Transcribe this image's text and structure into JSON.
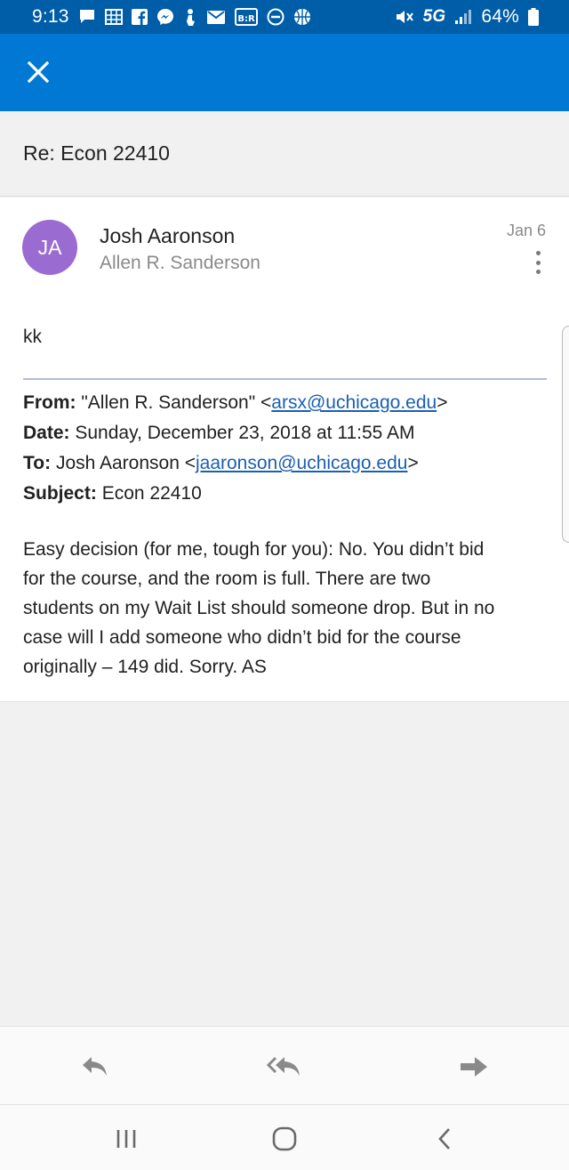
{
  "status_bar": {
    "time": "9:13",
    "network": "5G",
    "battery": "64%",
    "left_icons": [
      "chat-icon",
      "calendar-grid-icon",
      "facebook-icon",
      "messenger-icon",
      "touch-icon",
      "mail-icon",
      "br-app-icon",
      "minus-circle-icon",
      "basketball-icon"
    ],
    "br_label": "B:R",
    "right_icons": [
      "mute-icon",
      "signal-icon",
      "battery-icon"
    ]
  },
  "app_bar": {
    "close_icon": "close-icon",
    "color": "#0078d4"
  },
  "thread": {
    "subject": "Re: Econ 22410"
  },
  "message": {
    "avatar_initials": "JA",
    "avatar_color": "#9a6bd1",
    "sender": "Josh Aaronson",
    "recipient": "Allen R. Sanderson",
    "date": "Jan 6",
    "reply_text": "kk",
    "quoted_header": {
      "from_label": "From:",
      "from_name": "\"Allen R. Sanderson\" <",
      "from_email": "arsx@uchicago.edu",
      "from_suffix": ">",
      "date_label": "Date:",
      "date_value": "Sunday, December 23, 2018 at 11:55 AM",
      "to_label": "To:",
      "to_name": "Josh Aaronson <",
      "to_email": "jaaronson@uchicago.edu",
      "to_suffix": ">",
      "subject_label": "Subject:",
      "subject_value": "Econ 22410"
    },
    "body_lines": [
      "Easy decision (for me, tough for you): No. You didn’t bid",
      "for the course, and the room is full. There are two",
      "students on my Wait List should someone drop. But in no",
      "case will I add someone who didn’t bid for the course",
      "originally – 149 did. Sorry. AS"
    ]
  },
  "actions": {
    "reply_icon": "reply-icon",
    "reply_all_icon": "reply-all-icon",
    "forward_icon": "forward-icon"
  },
  "nav": {
    "recents_icon": "recents-icon",
    "home_icon": "home-icon",
    "back_icon": "back-icon"
  }
}
